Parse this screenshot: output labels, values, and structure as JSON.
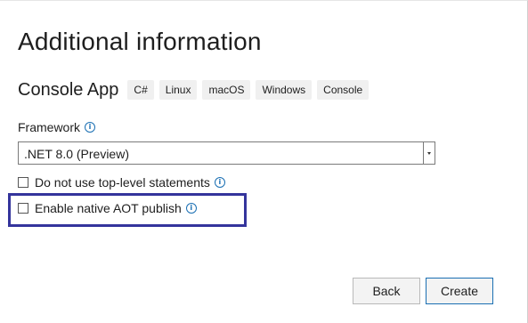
{
  "title": "Additional information",
  "template": {
    "name": "Console App",
    "tags": [
      "C#",
      "Linux",
      "macOS",
      "Windows",
      "Console"
    ]
  },
  "framework": {
    "label": "Framework",
    "selected": ".NET 8.0 (Preview)"
  },
  "options": [
    {
      "label": "Do not use top-level statements",
      "checked": false
    },
    {
      "label": "Enable native AOT publish",
      "checked": false
    }
  ],
  "buttons": {
    "back": "Back",
    "create": "Create"
  },
  "colors": {
    "highlight_border": "#34349c",
    "info_icon": "#1a6fb3",
    "primary_button_border": "#1a6fb3"
  },
  "icons": {
    "info": "info-icon",
    "dropdown": "chevron-down-icon"
  }
}
